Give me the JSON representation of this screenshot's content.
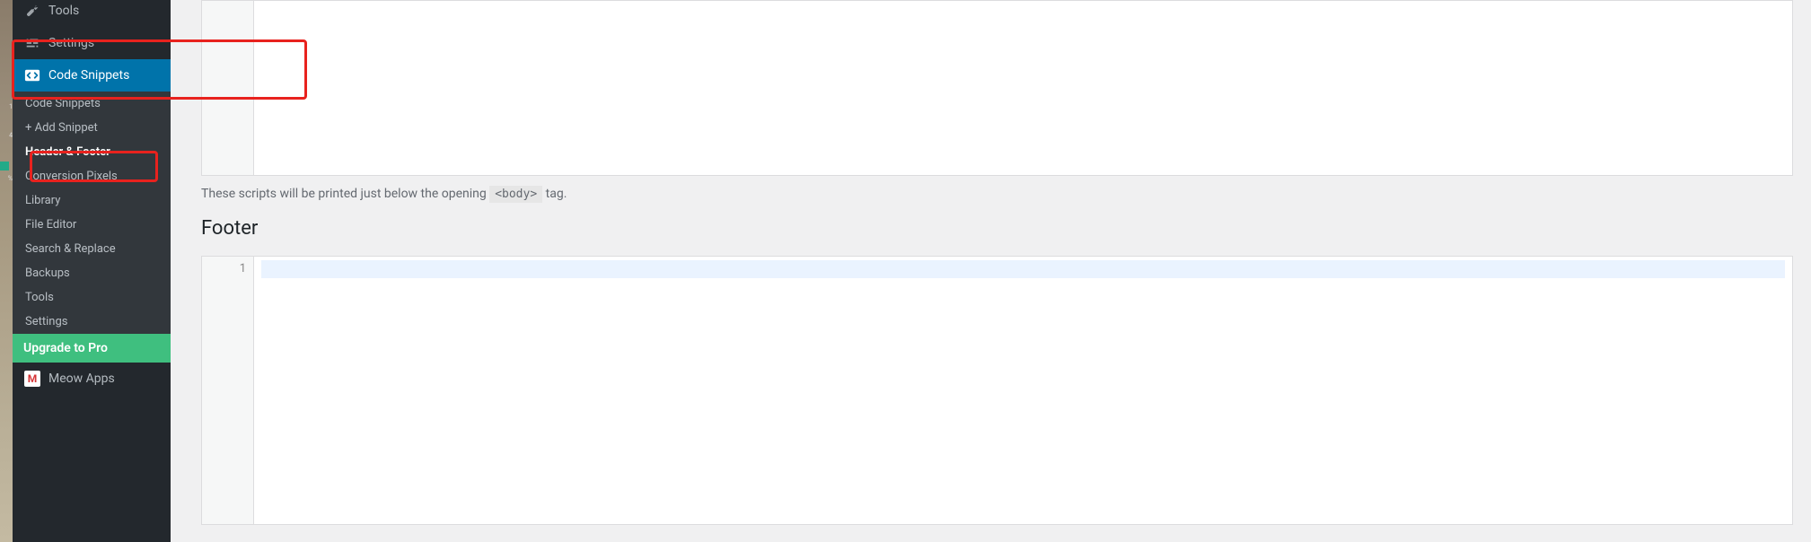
{
  "taskbar": {
    "indicators": [
      "1",
      "4",
      "%"
    ]
  },
  "sidebar": {
    "tools_label": "Tools",
    "settings_label": "Settings",
    "code_snippets": {
      "label": "Code Snippets",
      "submenu": [
        {
          "label": "Code Snippets"
        },
        {
          "label": "+ Add Snippet"
        },
        {
          "label": "Header & Footer",
          "current": true
        },
        {
          "label": "Conversion Pixels"
        },
        {
          "label": "Library"
        },
        {
          "label": "File Editor"
        },
        {
          "label": "Search & Replace"
        },
        {
          "label": "Backups"
        },
        {
          "label": "Tools"
        },
        {
          "label": "Settings"
        },
        {
          "label": "Upgrade to Pro",
          "upgrade": true
        }
      ]
    },
    "meow_apps_label": "Meow Apps"
  },
  "main": {
    "scripts_help_prefix": "These scripts will be printed just below the opening ",
    "scripts_help_code": "<body>",
    "scripts_help_suffix": " tag.",
    "section_title": "Footer",
    "footer_editor": {
      "line_number": "1"
    }
  }
}
